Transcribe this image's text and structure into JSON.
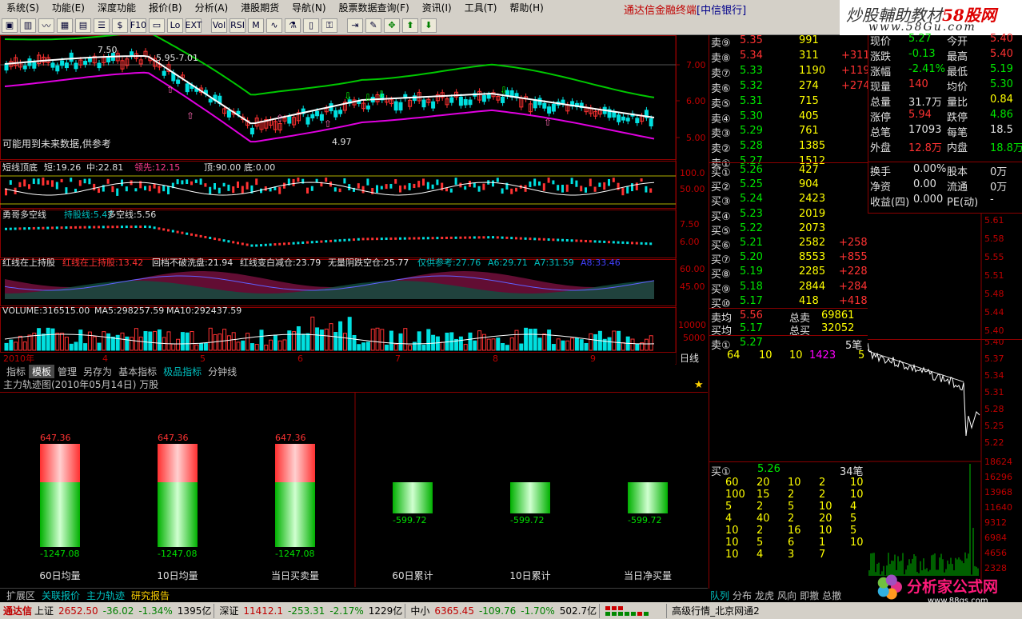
{
  "menubar": {
    "items": [
      "系统(S)",
      "功能(E)",
      "深度功能",
      "报价(B)",
      "分析(A)",
      "港股期货",
      "导航(N)",
      "股票数据查询(F)",
      "资讯(I)",
      "工具(T)",
      "帮助(H)"
    ],
    "app_title": "通达信金融终端",
    "bank": "[中信银行]"
  },
  "watermark": {
    "line1_prefix": "炒股輔助教材",
    "line1_brand": "58股网",
    "line2": "www.58Gu.com"
  },
  "toolbar": {
    "icons": [
      "chart-icon",
      "bar-icon",
      "line-icon",
      "grid-icon",
      "table-icon",
      "list-icon",
      "dollar-icon",
      "f10-icon",
      "window-icon",
      "lo-icon",
      "ext-icon",
      "vol-icon",
      "rsi-icon",
      "mac-icon",
      "wave-icon",
      "filter-icon",
      "book-icon",
      "key-icon",
      "login-icon",
      "pencil-icon",
      "move-icon",
      "up-arrow-icon",
      "down-arrow-icon"
    ],
    "labels": [
      "▣",
      "▥",
      "〰",
      "▦",
      "▤",
      "☰",
      "$",
      "F10",
      "▭",
      "Lo",
      "EXT",
      "Vol",
      "RSI",
      "M",
      "∿",
      "⚗",
      "▯",
      "⚿",
      "⇥",
      "✎",
      "✥",
      "⬆",
      "⬇"
    ]
  },
  "kline": {
    "note": "可能用到未来数据,供参考",
    "high_label": "7.50",
    "range_label": "5.95-7.01",
    "low_label": "4.97",
    "price_ticks": [
      "7.00",
      "6.00",
      "5.00"
    ],
    "colors": {
      "green_line": "#00c800",
      "white_line": "#ffffff",
      "magenta_line": "#e000e0"
    }
  },
  "indicator1": {
    "name": "短线顶底",
    "short": "短:19.26",
    "mid": "中:22.81",
    "lead": "领先:12.15",
    "top": "顶:90.00",
    "bottom": "底:0.00",
    "ticks": [
      "100.0",
      "50.00"
    ]
  },
  "indicator2": {
    "name": "勇哥多空线",
    "hold": "持股线:5.47",
    "duokong": "多空线:5.56",
    "ticks": [
      "7.50",
      "6.00"
    ]
  },
  "indicator3": {
    "name": "红线在上持股",
    "red_up": "红线在上持股:13.42",
    "hui": "回档不破洗盘:21.94",
    "red_white": "红线变白减仓:23.79",
    "wuliang": "无量阴跌空仓:25.77",
    "ref": "仅供参考:27.76",
    "a6": "A6:29.71",
    "a7": "A7:31.59",
    "a8": "A8:33.46",
    "ticks": [
      "60.00",
      "45.00"
    ]
  },
  "volume": {
    "label": "VOLUME:316515.00",
    "ma5": "MA5:298257.59",
    "ma10": "MA10:292437.59",
    "ticks": [
      "10000",
      "5000"
    ]
  },
  "x_axis": {
    "year": "2010年",
    "months": [
      "4",
      "5",
      "6",
      "7",
      "8",
      "9"
    ],
    "period": "日线"
  },
  "tabs1": [
    "指标",
    "模板",
    "管理",
    "另存为",
    "基本指标",
    "极品指标",
    "分钟线"
  ],
  "panel": {
    "title": "主力轨迹图(2010年05月14日) 万股",
    "bars": [
      {
        "label": "60日均量",
        "top": "647.36",
        "bottom": "-1247.08",
        "pos": 647.36,
        "neg": -1247.08
      },
      {
        "label": "10日均量",
        "top": "647.36",
        "bottom": "-1247.08",
        "pos": 647.36,
        "neg": -1247.08
      },
      {
        "label": "当日买卖量",
        "top": "647.36",
        "bottom": "-1247.08",
        "pos": 647.36,
        "neg": -1247.08
      },
      {
        "label": "60日累计",
        "top": "",
        "bottom": "-599.72",
        "pos": 0,
        "neg": -599.72
      },
      {
        "label": "10日累计",
        "top": "",
        "bottom": "-599.72",
        "pos": 0,
        "neg": -599.72
      },
      {
        "label": "当日净买量",
        "top": "",
        "bottom": "-599.72",
        "pos": 0,
        "neg": -599.72
      }
    ]
  },
  "tabs2": [
    "扩展区",
    "关联报价",
    "主力轨迹",
    "研究报告"
  ],
  "orderbook": {
    "sells": [
      {
        "label": "卖⑨",
        "price": "5.35",
        "vol": "991",
        "chg": ""
      },
      {
        "label": "卖⑧",
        "price": "5.34",
        "vol": "311",
        "chg": "+311"
      },
      {
        "label": "卖⑦",
        "price": "5.33",
        "vol": "1190",
        "chg": "+1190"
      },
      {
        "label": "卖⑥",
        "price": "5.32",
        "vol": "274",
        "chg": "+274"
      },
      {
        "label": "卖⑤",
        "price": "5.31",
        "vol": "715",
        "chg": ""
      },
      {
        "label": "卖④",
        "price": "5.30",
        "vol": "405",
        "chg": ""
      },
      {
        "label": "卖③",
        "price": "5.29",
        "vol": "761",
        "chg": ""
      },
      {
        "label": "卖②",
        "price": "5.28",
        "vol": "1385",
        "chg": ""
      },
      {
        "label": "卖①",
        "price": "5.27",
        "vol": "1512",
        "chg": ""
      }
    ],
    "buys": [
      {
        "label": "买①",
        "price": "5.26",
        "vol": "427",
        "chg": ""
      },
      {
        "label": "买②",
        "price": "5.25",
        "vol": "904",
        "chg": ""
      },
      {
        "label": "买③",
        "price": "5.24",
        "vol": "2423",
        "chg": ""
      },
      {
        "label": "买④",
        "price": "5.23",
        "vol": "2019",
        "chg": ""
      },
      {
        "label": "买⑤",
        "price": "5.22",
        "vol": "2073",
        "chg": ""
      },
      {
        "label": "买⑥",
        "price": "5.21",
        "vol": "2582",
        "chg": "+2582"
      },
      {
        "label": "买⑦",
        "price": "5.20",
        "vol": "8553",
        "chg": "+8553"
      },
      {
        "label": "买⑧",
        "price": "5.19",
        "vol": "2285",
        "chg": "+2285"
      },
      {
        "label": "买⑨",
        "price": "5.18",
        "vol": "2844",
        "chg": "+2844"
      },
      {
        "label": "买⑩",
        "price": "5.17",
        "vol": "418",
        "chg": "+418"
      }
    ],
    "avg_sell_label": "卖均",
    "avg_sell": "5.56",
    "total_sell_label": "总卖",
    "total_sell": "69861",
    "avg_buy_label": "买均",
    "avg_buy": "5.17",
    "total_buy_label": "总买",
    "total_buy": "32052",
    "queue_sell": {
      "label": "卖①",
      "price": "5.27",
      "count": "5笔",
      "vols": [
        "64",
        "10",
        "10",
        "1423",
        "5"
      ]
    },
    "queue_buy": {
      "label": "买①",
      "price": "5.26",
      "count": "34笔",
      "rows": [
        [
          "60",
          "20",
          "10",
          "2",
          "10"
        ],
        [
          "100",
          "15",
          "2",
          "2",
          "10"
        ],
        [
          "5",
          "2",
          "5",
          "10",
          "4"
        ],
        [
          "4",
          "40",
          "2",
          "20",
          "5"
        ],
        [
          "10",
          "2",
          "16",
          "10",
          "5"
        ],
        [
          "10",
          "5",
          "6",
          "1",
          "10"
        ],
        [
          "10",
          "4",
          "3",
          "7",
          ""
        ]
      ]
    }
  },
  "info": {
    "rows": [
      {
        "k1": "现价",
        "v1": "5.27",
        "k2": "今开",
        "v2": "5.40"
      },
      {
        "k1": "涨跌",
        "v1": "-0.13",
        "k2": "最高",
        "v2": "5.40"
      },
      {
        "k1": "涨幅",
        "v1": "-2.41%",
        "k2": "最低",
        "v2": "5.19"
      },
      {
        "k1": "现量",
        "v1": "140",
        "k2": "均价",
        "v2": "5.30"
      },
      {
        "k1": "总量",
        "v1": "31.7万",
        "k2": "量比",
        "v2": "0.84"
      },
      {
        "k1": "涨停",
        "v1": "5.94",
        "k2": "跌停",
        "v2": "4.86"
      },
      {
        "k1": "总笔",
        "v1": "17093",
        "k2": "每笔",
        "v2": "18.5"
      },
      {
        "k1": "外盘",
        "v1": "12.8万",
        "k2": "内盘",
        "v2": "18.8万"
      }
    ],
    "rows2": [
      {
        "k1": "换手",
        "v1": "0.00%",
        "k2": "股本",
        "v2": "0万"
      },
      {
        "k1": "净资",
        "v1": "0.00",
        "k2": "流通",
        "v2": "0万"
      },
      {
        "k1": "收益(四)",
        "v1": "0.000",
        "k2": "PE(动)",
        "v2": "-"
      }
    ]
  },
  "mini_price": {
    "ticks": [
      "5.61",
      "5.58",
      "5.55",
      "5.51",
      "5.48",
      "5.44",
      "5.40",
      "5.37",
      "5.34",
      "5.31",
      "5.28",
      "5.25",
      "5.22"
    ]
  },
  "mini_vol": {
    "ticks": [
      "18624",
      "16296",
      "13968",
      "11640",
      "9312",
      "6984",
      "4656",
      "2328"
    ]
  },
  "rtabs": [
    "队列",
    "分布",
    "龙虎",
    "风向",
    "即撤",
    "总撤",
    "总手"
  ],
  "logo": {
    "text": "分析家公式网",
    "url": "www.88gs.com"
  },
  "status": {
    "brand": "通达信",
    "sh": {
      "name": "上证",
      "val": "2652.50",
      "chg": "-36.02",
      "pct": "-1.34%",
      "amt": "1395亿"
    },
    "sz": {
      "name": "深证",
      "val": "11412.1",
      "chg": "-253.31",
      "pct": "-2.17%",
      "amt": "1229亿"
    },
    "zx": {
      "name": "中小",
      "val": "6365.45",
      "chg": "-109.76",
      "pct": "-1.70%",
      "amt": "502.7亿"
    },
    "server": "高级行情_北京网通2"
  },
  "chart_data": {
    "type": "bar",
    "title": "主力轨迹图(2010年05月14日) 万股",
    "categories": [
      "60日均量",
      "10日均量",
      "当日买卖量",
      "60日累计",
      "10日累计",
      "当日净买量"
    ],
    "series": [
      {
        "values": [
          647.36,
          647.36,
          647.36,
          0,
          0,
          0
        ]
      },
      {
        "values": [
          -1247.08,
          -1247.08,
          -1247.08,
          -599.72,
          -599.72,
          -599.72
        ]
      }
    ]
  }
}
